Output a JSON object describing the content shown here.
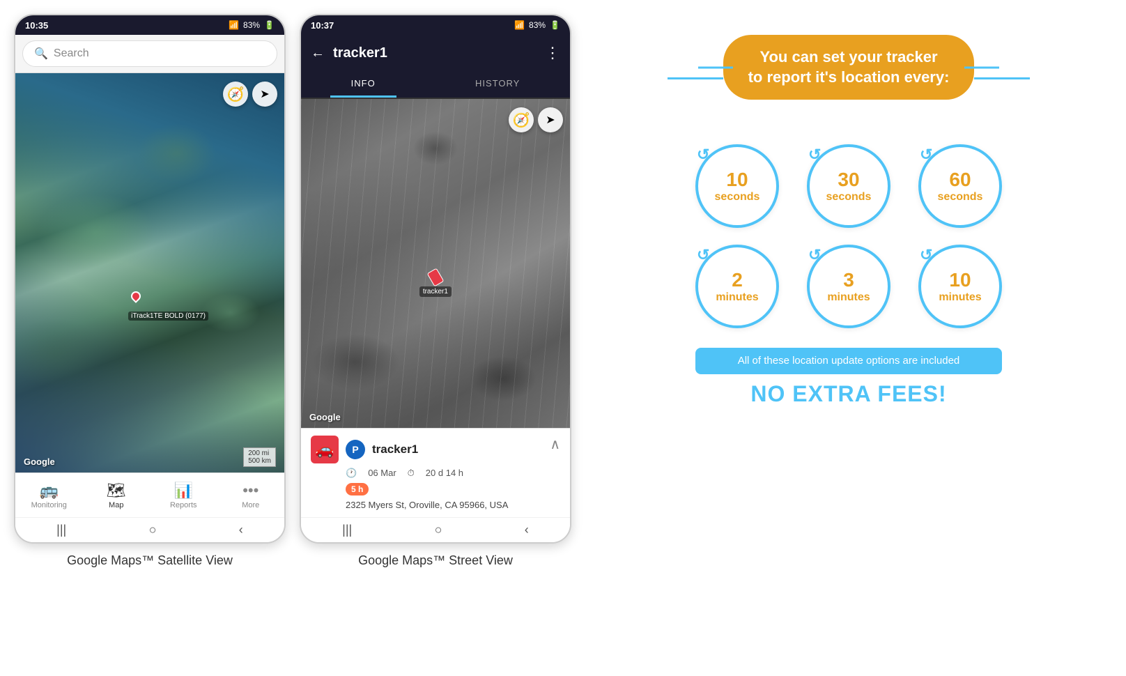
{
  "phone1": {
    "status_time": "10:35",
    "status_right": "83%",
    "search_placeholder": "Search",
    "google_logo": "Google",
    "scale_text": "200 mi\n500 km",
    "tracker_label": "iTrack1TE BOLD (0177)",
    "nav_items": [
      {
        "icon": "🚌",
        "label": "Monitoring",
        "active": false
      },
      {
        "icon": "🗺",
        "label": "Map",
        "active": true
      },
      {
        "icon": "📊",
        "label": "Reports",
        "active": false
      },
      {
        "icon": "•••",
        "label": "More",
        "active": false
      }
    ],
    "caption": "Google Maps™ Satellite View"
  },
  "phone2": {
    "status_time": "10:37",
    "status_right": "83%",
    "back_icon": "←",
    "title": "tracker1",
    "menu_icon": "⋮",
    "tabs": [
      {
        "label": "INFO",
        "active": true
      },
      {
        "label": "HISTORY",
        "active": false
      }
    ],
    "google_logo": "Google",
    "tracker_label": "tracker1",
    "info": {
      "car_icon": "🚗",
      "p_badge": "P",
      "name": "tracker1",
      "date": "06 Mar",
      "duration": "20 d 14 h",
      "time_badge": "5 h",
      "address": "2325 Myers St, Oroville, CA 95966, USA"
    },
    "caption": "Google Maps™ Street View"
  },
  "tracker": {
    "headline": "You can set your tracker\nto report it's location every:",
    "circles": [
      {
        "number": "10",
        "unit": "seconds"
      },
      {
        "number": "30",
        "unit": "seconds"
      },
      {
        "number": "60",
        "unit": "seconds"
      },
      {
        "number": "2",
        "unit": "minutes"
      },
      {
        "number": "3",
        "unit": "minutes"
      },
      {
        "number": "10",
        "unit": "minutes"
      }
    ],
    "banner_text": "All of these location update options are included",
    "no_fees": "NO EXTRA FEES!"
  }
}
